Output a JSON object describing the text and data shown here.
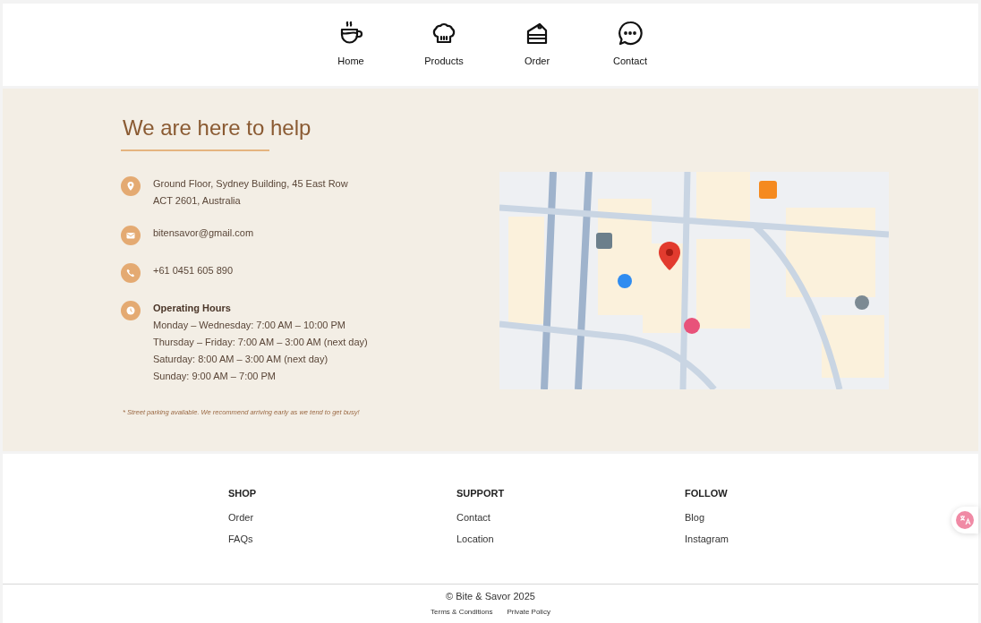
{
  "nav": [
    {
      "kind": "cup",
      "label": "Home"
    },
    {
      "kind": "chef",
      "label": "Products"
    },
    {
      "kind": "cake",
      "label": "Order"
    },
    {
      "kind": "chat",
      "label": "Contact"
    }
  ],
  "contact": {
    "title": "We are here to help",
    "items": [
      {
        "kind": "pin",
        "lines": [
          "Ground Floor, Sydney Building, 45 East Row",
          "ACT 2601, Australia"
        ]
      },
      {
        "kind": "mail",
        "lines": [
          "bitensavor@gmail.com"
        ]
      },
      {
        "kind": "phone",
        "lines": [
          "+61 0451 605 890"
        ]
      },
      {
        "kind": "clock",
        "heading": "Operating Hours",
        "lines": [
          "Monday – Wednesday: 7:00 AM – 10:00 PM",
          "Thursday – Friday: 7:00 AM – 3:00 AM (next day)",
          "Saturday: 8:00 AM – 3:00 AM (next day)",
          "Sunday: 9:00 AM – 7:00 PM"
        ]
      }
    ],
    "note": "* Street parking available. We recommend arriving early as we tend to get busy!"
  },
  "footer": {
    "columns": [
      {
        "heading": "SHOP",
        "links": [
          "Order",
          "FAQs"
        ]
      },
      {
        "heading": "SUPPORT",
        "links": [
          "Contact",
          "Location"
        ]
      },
      {
        "heading": "FOLLOW",
        "links": [
          "Blog",
          "Instagram"
        ]
      }
    ],
    "copyright": "© Bite & Savor 2025",
    "legal": [
      "Terms & Conditions",
      "Private Policy"
    ]
  }
}
